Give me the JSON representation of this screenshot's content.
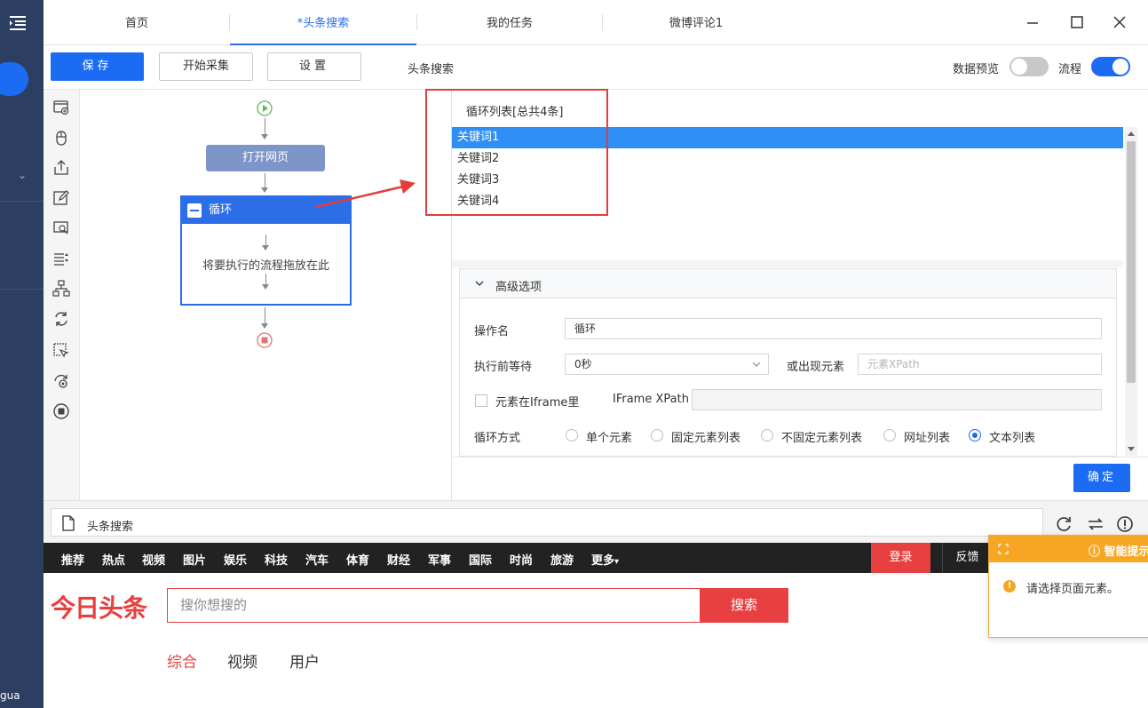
{
  "tabs": [
    {
      "label": "首页",
      "active": false
    },
    {
      "label": "*头条搜索",
      "active": true
    },
    {
      "label": "我的任务",
      "active": false
    },
    {
      "label": "微博评论1",
      "active": false
    }
  ],
  "toolbar": {
    "save_label": "保存",
    "start_label": "开始采集",
    "settings_label": "设置",
    "task_name": "头条搜索",
    "data_preview_label": "数据预览",
    "data_preview_on": false,
    "flow_label": "流程",
    "flow_on": true
  },
  "flow": {
    "open_page_label": "打开网页",
    "loop_label": "循环",
    "loop_hint": "将要执行的流程拖放在此"
  },
  "loop_list": {
    "header": "循环列表[总共4条]",
    "items": [
      "关键词1",
      "关键词2",
      "关键词3",
      "关键词4"
    ],
    "selected_index": 0
  },
  "advanced": {
    "title": "高级选项",
    "op_name_label": "操作名",
    "op_name_value": "循环",
    "wait_label": "执行前等待",
    "wait_value": "0秒",
    "or_element_label": "或出现元素",
    "xpath_placeholder": "元素XPath",
    "iframe_checkbox_label": "元素在Iframe里",
    "iframe_xpath_label": "IFrame XPath",
    "loop_mode_label": "循环方式",
    "loop_modes": [
      "单个元素",
      "固定元素列表",
      "不固定元素列表",
      "网址列表",
      "文本列表"
    ],
    "selected_mode": "文本列表"
  },
  "confirm_label": "确定",
  "urlbar": {
    "text": "头条搜索"
  },
  "page": {
    "nav": [
      "推荐",
      "热点",
      "视频",
      "图片",
      "娱乐",
      "科技",
      "汽车",
      "体育",
      "财经",
      "军事",
      "国际",
      "时尚",
      "旅游",
      "更多"
    ],
    "login_label": "登录",
    "feedback_label": "反馈",
    "logo": "今日头条",
    "search_placeholder": "搜你想搜的",
    "search_button": "搜索",
    "subtabs": [
      "综合",
      "视频",
      "用户"
    ]
  },
  "tip": {
    "title": "智能提示",
    "message": "请选择页面元素。"
  },
  "sidebar_text": "gua",
  "colors": {
    "accent": "#1b6cf2",
    "brand_red": "#e84040",
    "warning": "#f6a623"
  }
}
